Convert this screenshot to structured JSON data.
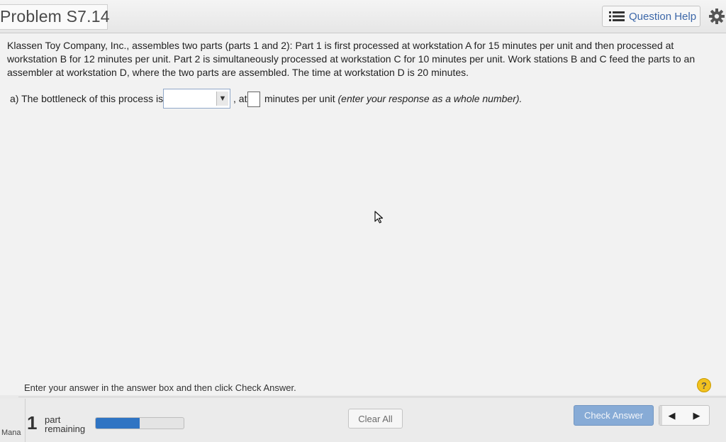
{
  "header": {
    "title": "Problem S7.14",
    "help_label": "Question Help"
  },
  "problem": {
    "text": "Klassen Toy Company, Inc., assembles two parts (parts 1 and 2): Part 1 is first processed at workstation A for 15 minutes per unit and then processed at workstation B for 12 minutes per unit. Part 2 is simultaneously processed at workstation C for 10 minutes per unit. Work stations B and C feed the parts to an assembler at workstation D, where the two parts are assembled. The time at workstation D is 20 minutes."
  },
  "question": {
    "label": "a) The bottleneck of this process is",
    "selected": "",
    "at_text": ", at",
    "value": "",
    "unit_text": "minutes per unit",
    "hint": "(enter your response as a whole number)."
  },
  "footer": {
    "instructions": "Enter your answer in the answer box and then click Check Answer.",
    "help_glyph": "?",
    "mana_text": "Mana",
    "parts_count": "1",
    "parts_label_line1": "part",
    "parts_label_line2": "remaining",
    "progress_percent": 50,
    "clear_label": "Clear All",
    "check_label": "Check Answer",
    "prev_glyph": "◀",
    "next_glyph": "▶"
  },
  "colors": {
    "accent": "#3c67a8",
    "check_button": "#87abd6",
    "progress_fill": "#2f74c3",
    "help_badge": "#f2c21f"
  },
  "icons": {
    "help_list": "list-icon",
    "settings": "gear-icon",
    "dropdown": "dropdown-arrow-icon",
    "cursor": "mouse-pointer-icon",
    "help_badge": "question-mark-icon"
  }
}
